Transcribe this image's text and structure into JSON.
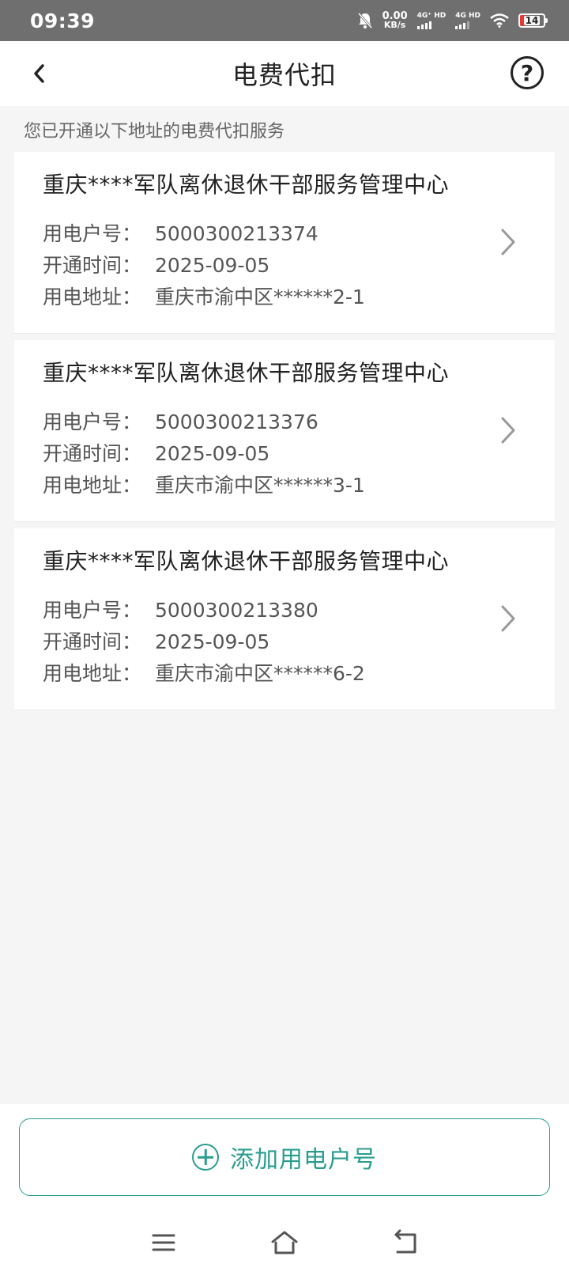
{
  "status_bar": {
    "time": "09:39",
    "net_speed_value": "0.00",
    "net_speed_unit": "KB/s",
    "sim1_label": "4G⁺ HD",
    "sim2_label": "4G HD",
    "battery_level": "14",
    "icons": [
      "mute-bell-icon",
      "signal-icon",
      "wifi-icon",
      "battery-icon"
    ]
  },
  "header": {
    "title": "电费代扣",
    "back_icon": "chevron-left-icon",
    "help_icon": "question-circle-icon",
    "help_glyph": "?"
  },
  "subtitle": "您已开通以下地址的电费代扣服务",
  "accounts": [
    {
      "name": "重庆****军队离休退休干部服务管理中心",
      "account_label": "用电户号：",
      "account_no": "5000300213374",
      "open_label": "开通时间：",
      "open_date": "2025-09-05",
      "address_label": "用电地址：",
      "address": "重庆市渝中区******2-1"
    },
    {
      "name": "重庆****军队离休退休干部服务管理中心",
      "account_label": "用电户号：",
      "account_no": "5000300213376",
      "open_label": "开通时间：",
      "open_date": "2025-09-05",
      "address_label": "用电地址：",
      "address": "重庆市渝中区******3-1"
    },
    {
      "name": "重庆****军队离休退休干部服务管理中心",
      "account_label": "用电户号：",
      "account_no": "5000300213380",
      "open_label": "开通时间：",
      "open_date": "2025-09-05",
      "address_label": "用电地址：",
      "address": "重庆市渝中区******6-2"
    }
  ],
  "add_button": {
    "label": "添加用电户号",
    "icon": "plus-circle-icon"
  },
  "nav_bar": {
    "icons": [
      "menu-icon",
      "home-icon",
      "back-icon"
    ]
  },
  "colors": {
    "accent": "#2a9d8f",
    "status_bar_bg": "#6f6f6f",
    "battery_low": "#e53935"
  }
}
